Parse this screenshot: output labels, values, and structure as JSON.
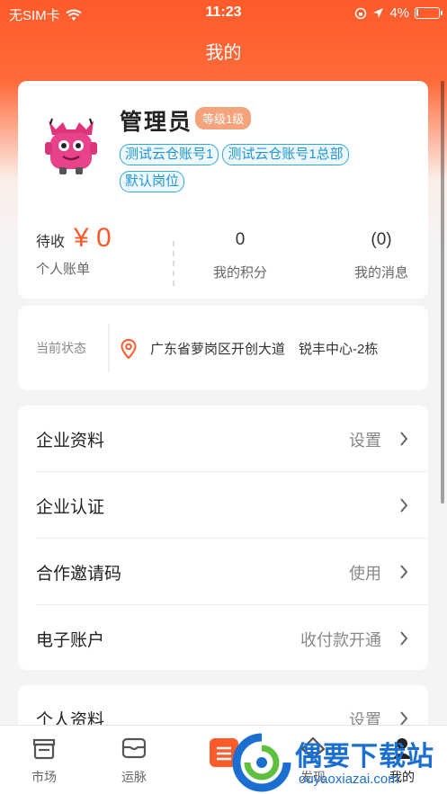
{
  "status_bar": {
    "carrier": "无SIM卡",
    "time": "11:23",
    "battery_percent": "4%",
    "battery_level": 0.04
  },
  "nav": {
    "title": "我的"
  },
  "profile": {
    "name": "管理员",
    "level": "等级1级",
    "tags": [
      "测试云仓账号1",
      "测试云仓账号1总部",
      "默认岗位"
    ]
  },
  "stats": {
    "pending_label": "待收",
    "pending_amount": "¥ 0",
    "account_label": "个人账单",
    "points_value": "0",
    "points_label": "我的积分",
    "messages_value": "(0)",
    "messages_label": "我的消息"
  },
  "current_status": {
    "label": "当前状态",
    "location": "广东省萝岗区开创大道　锐丰中心-2栋"
  },
  "menu": [
    {
      "label": "企业资料",
      "value": "设置"
    },
    {
      "label": "企业认证",
      "value": ""
    },
    {
      "label": "合作邀请码",
      "value": "使用"
    },
    {
      "label": "电子账户",
      "value": "收付款开通"
    }
  ],
  "menu2": [
    {
      "label": "个人资料",
      "value": "设置"
    }
  ],
  "tabs": [
    {
      "label": "市场",
      "icon": "market-icon"
    },
    {
      "label": "运脉",
      "icon": "wallet-icon"
    },
    {
      "label": "",
      "icon": "center-menu-icon"
    },
    {
      "label": "发现",
      "icon": "discover-icon"
    },
    {
      "label": "我的",
      "icon": "profile-icon"
    }
  ],
  "watermark": {
    "title": "偶要下载站",
    "url": "ouyaoxiazai.com"
  },
  "colors": {
    "accent": "#ff5a2a",
    "tag_blue": "#2196d3",
    "level_orange": "#f5a37c"
  }
}
